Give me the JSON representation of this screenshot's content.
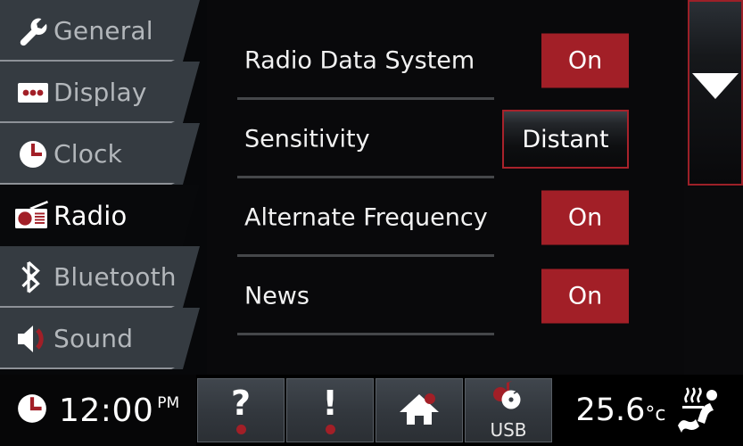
{
  "sidebar": {
    "items": [
      {
        "label": "General",
        "icon": "wrench-icon",
        "selected": false
      },
      {
        "label": "Display",
        "icon": "display-icon",
        "selected": false
      },
      {
        "label": "Clock",
        "icon": "clock-icon",
        "selected": false
      },
      {
        "label": "Radio",
        "icon": "radio-icon",
        "selected": true
      },
      {
        "label": "Bluetooth",
        "icon": "bluetooth-icon",
        "selected": false
      },
      {
        "label": "Sound",
        "icon": "speaker-icon",
        "selected": false
      }
    ]
  },
  "main": {
    "rows": [
      {
        "label": "Radio Data System",
        "value": "On",
        "state": "on"
      },
      {
        "label": "Sensitivity",
        "value": "Distant",
        "state": "selected"
      },
      {
        "label": "Alternate Frequency",
        "value": "On",
        "state": "on"
      },
      {
        "label": "News",
        "value": "On",
        "state": "on"
      }
    ]
  },
  "scrollbar": {
    "up_label": "scroll-up",
    "down_label": "scroll-down",
    "up_enabled": false,
    "down_enabled": true
  },
  "bottom_bar": {
    "clock": {
      "time": "12:00",
      "ampm": "PM",
      "icon": "clock-icon"
    },
    "buttons": [
      {
        "glyph": "?",
        "sub": "",
        "icon": "help-icon",
        "badge": true
      },
      {
        "glyph": "!",
        "sub": "",
        "icon": "alert-icon",
        "badge": true
      },
      {
        "glyph": "",
        "sub": "",
        "icon": "home-icon",
        "badge": true
      },
      {
        "glyph": "",
        "sub": "USB",
        "icon": "usb-media-icon",
        "badge": false
      }
    ],
    "temperature": {
      "value": "25.6",
      "unit": "°c"
    },
    "seat_icon": "heated-seat-icon"
  },
  "colors": {
    "accent_red": "#a21f27",
    "panel_gray": "#353b41",
    "background": "#09090b",
    "text_primary": "#ffffff",
    "text_secondary": "#b3b7bb"
  }
}
